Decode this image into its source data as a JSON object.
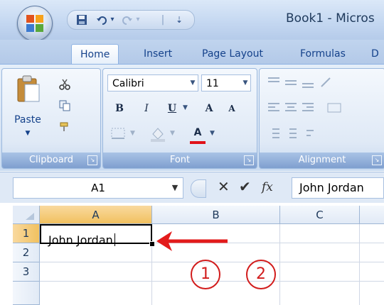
{
  "window": {
    "title": "Book1 - Micros"
  },
  "quick_access": {
    "separator": "|",
    "undo_arrow": "▾",
    "redo_arrow": "▾",
    "more": "⇣"
  },
  "tabs": [
    {
      "label": "Home"
    },
    {
      "label": "Insert"
    },
    {
      "label": "Page Layout"
    },
    {
      "label": "Formulas"
    },
    {
      "label": "D"
    }
  ],
  "ribbon": {
    "clipboard": {
      "label": "Clipboard",
      "paste_label": "Paste"
    },
    "font": {
      "label": "Font",
      "font_name": "Calibri",
      "font_size": "11",
      "bold": "B",
      "italic": "I",
      "underline": "U",
      "grow": "A",
      "shrink": "A",
      "font_color": "A",
      "font_color_hex": "#e0121a"
    },
    "alignment": {
      "label": "Alignment"
    }
  },
  "formula_bar": {
    "name_box": "A1",
    "cancel": "✕",
    "enter": "✔",
    "fx": "fx",
    "content": "John Jordan"
  },
  "grid": {
    "columns": [
      "A",
      "B",
      "C"
    ],
    "rows": [
      "1",
      "2",
      "3"
    ],
    "active_cell": "A1",
    "a1_value": "John Jordan"
  },
  "annotations": {
    "arrow_color": "#e31b1b",
    "markers": [
      "1",
      "2"
    ]
  }
}
